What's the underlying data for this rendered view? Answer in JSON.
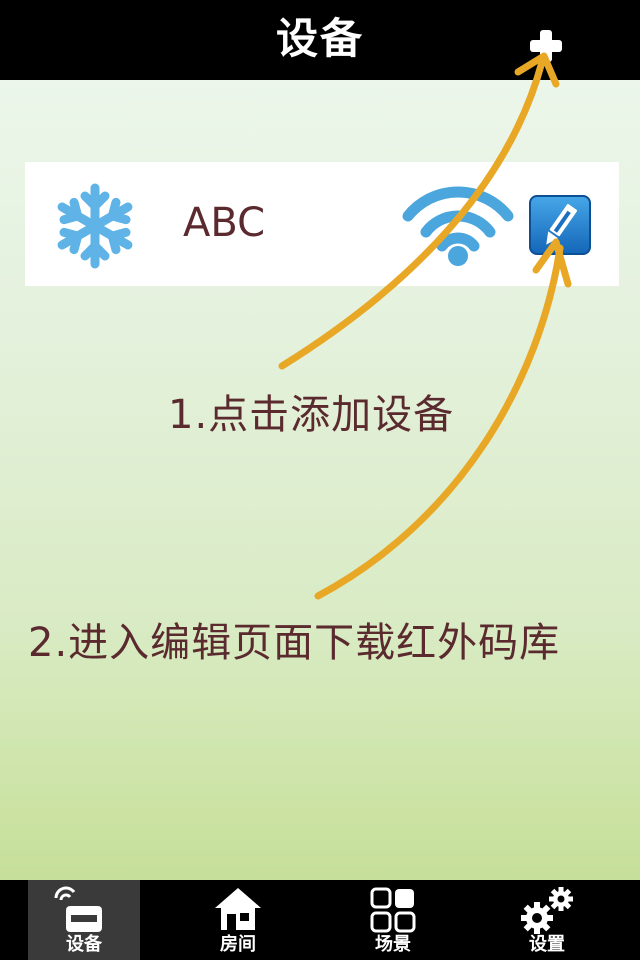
{
  "header": {
    "title": "设备",
    "add_icon": "plus-icon"
  },
  "device": {
    "name": "ABC",
    "type_icon": "snowflake-icon",
    "status_icon": "wifi-icon",
    "edit_icon": "edit-icon"
  },
  "hints": {
    "step1": "1.点击添加设备",
    "step2": "2.进入编辑页面下载红外码库"
  },
  "tabs": [
    {
      "label": "设备",
      "icon": "device-icon",
      "active": true
    },
    {
      "label": "房间",
      "icon": "house-icon",
      "active": false
    },
    {
      "label": "场景",
      "icon": "grid-icon",
      "active": false
    },
    {
      "label": "设置",
      "icon": "gears-icon",
      "active": false
    }
  ],
  "colors": {
    "accent_arrow": "#e8a826",
    "text": "#5a2a2e",
    "wifi": "#4aa6dc",
    "snowflake": "#5fb3e6"
  }
}
